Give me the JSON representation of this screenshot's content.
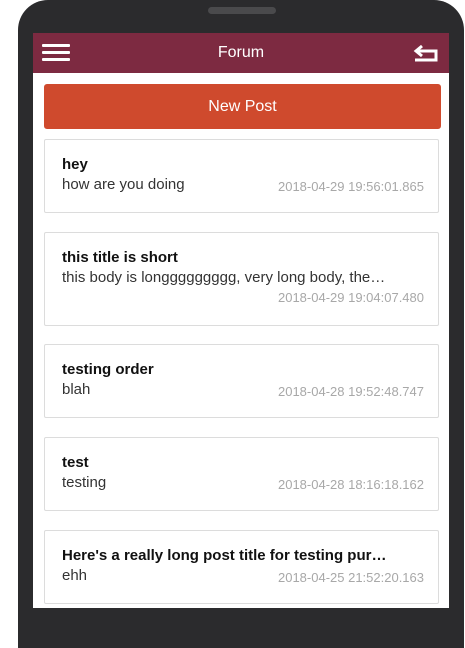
{
  "header": {
    "title": "Forum",
    "menu_icon": "hamburger-menu-icon",
    "back_icon": "back-arrow-icon",
    "bar_color": "#7d2a41"
  },
  "new_post_button": {
    "label": "New Post",
    "color": "#cf4a2d"
  },
  "posts": [
    {
      "title": "hey",
      "body": "how are you doing",
      "date": "2018-04-29 19:56:01.865"
    },
    {
      "title": "this title is short",
      "body": "this body is longgggggggg, very long body, the…",
      "date": "2018-04-29 19:04:07.480"
    },
    {
      "title": "testing order",
      "body": "blah",
      "date": "2018-04-28 19:52:48.747"
    },
    {
      "title": "test",
      "body": "testing",
      "date": "2018-04-28 18:16:18.162"
    },
    {
      "title": "Here's a really long post title for testing pur…",
      "body": "ehh",
      "date": "2018-04-25 21:52:20.163"
    }
  ]
}
